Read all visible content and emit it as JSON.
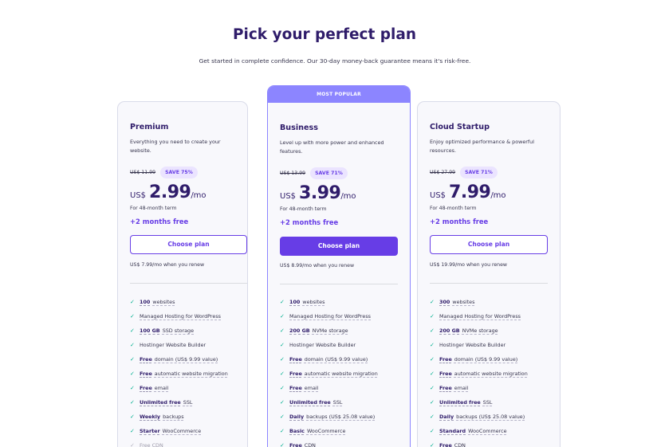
{
  "header": {
    "title": "Pick your perfect plan",
    "subtitle": "Get started in complete confidence. Our 30-day money-back guarantee means it's risk-free."
  },
  "plans": [
    {
      "name": "Premium",
      "description": "Everything you need to create your website.",
      "old_price": "US$ 11.99",
      "save_label": "SAVE 75%",
      "currency": "US$",
      "price": "2.99",
      "per": "/mo",
      "term": "For 48-month term",
      "bonus": "+2 months free",
      "button": "Choose plan",
      "renew": "US$ 7.99/mo when you renew",
      "features": [
        {
          "bold": "100",
          "rest": "websites"
        },
        {
          "bold": "",
          "rest": "Managed Hosting for WordPress"
        },
        {
          "bold": "100 GB",
          "rest": "SSD storage"
        },
        {
          "bold": "",
          "rest": "Hostinger Website Builder"
        },
        {
          "bold": "Free",
          "rest": "domain (US$ 9.99 value)"
        },
        {
          "bold": "Free",
          "rest": "automatic website migration"
        },
        {
          "bold": "Free",
          "rest": "email"
        },
        {
          "bold": "Unlimited free",
          "rest": "SSL"
        },
        {
          "bold": "Weekly",
          "rest": "backups"
        },
        {
          "bold": "Starter",
          "rest": "WooCommerce"
        },
        {
          "bold": "",
          "rest": "Free CDN"
        }
      ]
    },
    {
      "badge": "MOST POPULAR",
      "name": "Business",
      "description": "Level up with more power and enhanced features.",
      "old_price": "US$ 13.99",
      "save_label": "SAVE 71%",
      "currency": "US$",
      "price": "3.99",
      "per": "/mo",
      "term": "For 48-month term",
      "bonus": "+2 months free",
      "button": "Choose plan",
      "renew": "US$ 8.99/mo when you renew",
      "features": [
        {
          "bold": "100",
          "rest": "websites"
        },
        {
          "bold": "",
          "rest": "Managed Hosting for WordPress"
        },
        {
          "bold": "200 GB",
          "rest": "NVMe storage"
        },
        {
          "bold": "",
          "rest": "Hostinger Website Builder"
        },
        {
          "bold": "Free",
          "rest": "domain (US$ 9.99 value)"
        },
        {
          "bold": "Free",
          "rest": "automatic website migration"
        },
        {
          "bold": "Free",
          "rest": "email"
        },
        {
          "bold": "Unlimited free",
          "rest": "SSL"
        },
        {
          "bold": "Daily",
          "rest": "backups (US$ 25.08 value)"
        },
        {
          "bold": "Basic",
          "rest": "WooCommerce"
        },
        {
          "bold": "Free",
          "rest": "CDN"
        }
      ]
    },
    {
      "name": "Cloud Startup",
      "description": "Enjoy optimized performance & powerful resources.",
      "old_price": "US$ 27.99",
      "save_label": "SAVE 71%",
      "currency": "US$",
      "price": "7.99",
      "per": "/mo",
      "term": "For 48-month term",
      "bonus": "+2 months free",
      "button": "Choose plan",
      "renew": "US$ 19.99/mo when you renew",
      "features": [
        {
          "bold": "300",
          "rest": "websites"
        },
        {
          "bold": "",
          "rest": "Managed Hosting for WordPress"
        },
        {
          "bold": "200 GB",
          "rest": "NVMe storage"
        },
        {
          "bold": "",
          "rest": "Hostinger Website Builder"
        },
        {
          "bold": "Free",
          "rest": "domain (US$ 9.99 value)"
        },
        {
          "bold": "Free",
          "rest": "automatic website migration"
        },
        {
          "bold": "Free",
          "rest": "email"
        },
        {
          "bold": "Unlimited free",
          "rest": "SSL"
        },
        {
          "bold": "Daily",
          "rest": "backups (US$ 25.08 value)"
        },
        {
          "bold": "Standard",
          "rest": "WooCommerce"
        },
        {
          "bold": "Free",
          "rest": "CDN"
        }
      ]
    }
  ],
  "colors": {
    "accent": "#673de6",
    "popular_badge": "#8c85ff",
    "heading": "#2f1c6a",
    "check": "#00b090"
  },
  "icons": {
    "feature": "check-icon"
  }
}
